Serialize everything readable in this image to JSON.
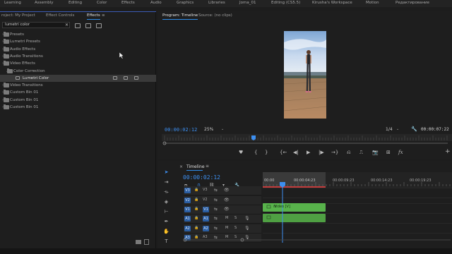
{
  "workspaces": [
    "Learning",
    "Assembly",
    "Editing",
    "Color",
    "Effects",
    "Audio",
    "Graphics",
    "Libraries",
    "Joma_01",
    "Editing (CS5.5)",
    "Kirusha's Workspace",
    "Motion",
    "Редактирование"
  ],
  "left_panel": {
    "tabs": [
      "roject: My Project",
      "Effect Controls",
      "Effects"
    ],
    "menu_glyph": "≡",
    "search_value": "lumetri color",
    "clear_glyph": "✕",
    "effects_tree": [
      {
        "label": "Presets",
        "indent": 0
      },
      {
        "label": "Lumetri Presets",
        "indent": 0
      },
      {
        "label": "Audio Effects",
        "indent": 0
      },
      {
        "label": "Audio Transitions",
        "indent": 0
      },
      {
        "label": "Video Effects",
        "indent": 0
      },
      {
        "label": "Color Correction",
        "indent": 1,
        "expanded": true
      },
      {
        "label": "Lumetri Color",
        "indent": 2,
        "selected": true,
        "effect": true
      },
      {
        "label": "Video Transitions",
        "indent": 0
      },
      {
        "label": "Custom Bin 01",
        "indent": 0
      },
      {
        "label": "Custom Bin 01",
        "indent": 0
      },
      {
        "label": "Custom Bin 01",
        "indent": 0
      }
    ]
  },
  "program_monitor": {
    "tabs": [
      "Program: Timeline",
      "Source: (no clips)"
    ],
    "menu_glyph": "≡",
    "current_timecode": "00:00:02:12",
    "zoom": "25%",
    "resolution": "1/4",
    "duration": "00:00:07:22",
    "playhead_fraction": 0.315,
    "controls": [
      "♥",
      "{",
      "}",
      "{←",
      "◀|",
      "▶",
      "|▶",
      "→}",
      "⎌",
      "⎍",
      "📷",
      "⊞",
      "fx",
      "+"
    ]
  },
  "timeline": {
    "tab": "Timeline",
    "close_glyph": "×",
    "menu_glyph": "≡",
    "current_timecode": "00:00:02:12",
    "ruler_labels": [
      "00:00",
      "00:00:04:23",
      "00:00:09:23",
      "00:00:14:23",
      "00:00:19:23"
    ],
    "video_tracks": [
      {
        "src": "V3",
        "name": "V3"
      },
      {
        "src": "V2",
        "name": "V2"
      },
      {
        "src": "V1",
        "name": "V1"
      }
    ],
    "audio_tracks": [
      {
        "src": "A1",
        "name": "A1",
        "m": "M",
        "s": "S"
      },
      {
        "src": "A2",
        "name": "A2",
        "m": "M",
        "s": "S"
      },
      {
        "src": "A3",
        "name": "A3",
        "m": "M",
        "s": "S"
      }
    ],
    "clip_label": "Video [V]",
    "clip_fx_glyph": "fx"
  },
  "colors": {
    "accent_blue": "#2d8ceb",
    "clip_green": "#58b34b",
    "track_blue": "#2a5da1",
    "playhead": "#3d8ff0",
    "workarea_red": "#c23b3b"
  }
}
